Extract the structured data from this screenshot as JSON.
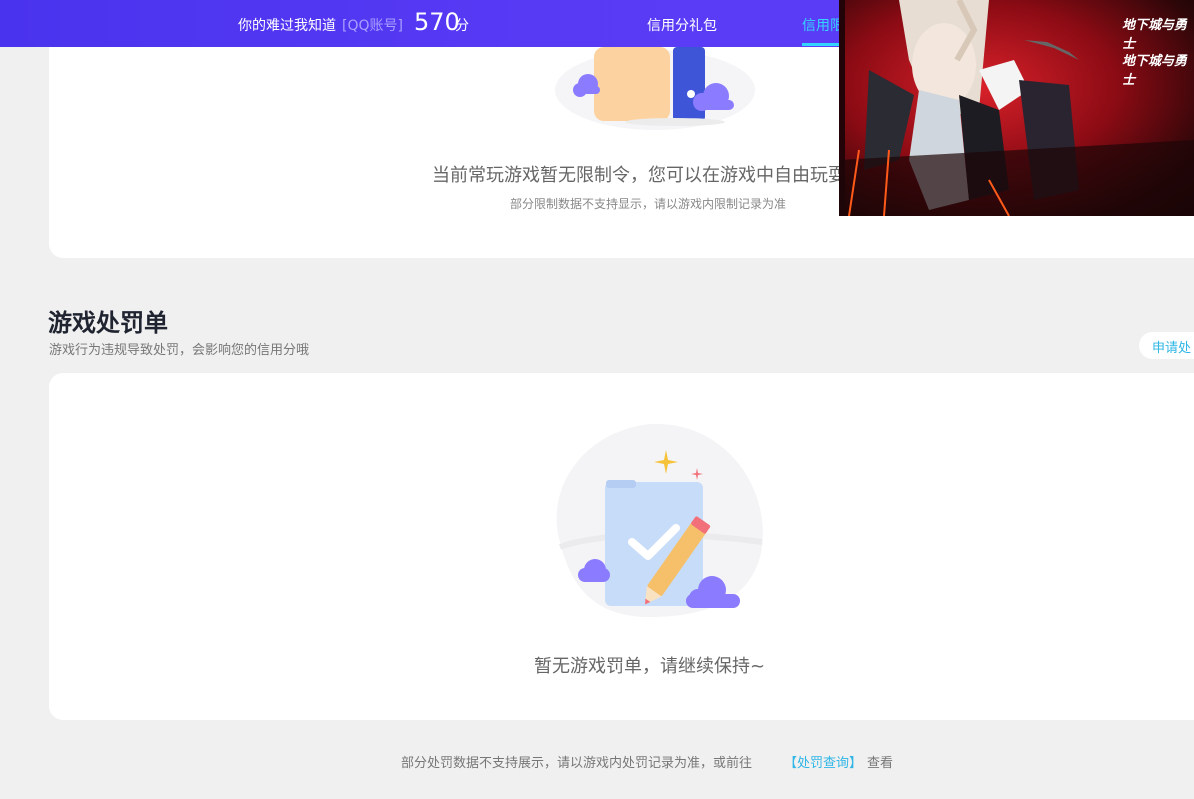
{
  "header": {
    "username": "你的难过我知道",
    "account_type": "[QQ账号]",
    "score": "570",
    "score_unit": "分",
    "nav": [
      {
        "label": "信用分礼包"
      },
      {
        "label": "信用限"
      }
    ]
  },
  "banner": {
    "logo_text_1": "地下城与勇士",
    "logo_text_2": "地下城与勇士"
  },
  "restrictions": {
    "message": "当前常玩游戏暂无限制令，您可以在游戏中自由玩耍",
    "note": "部分限制数据不支持显示，请以游戏内限制记录为准"
  },
  "penalty_section": {
    "title": "游戏处罚单",
    "description": "游戏行为违规导致处罚，会影响您的信用分哦",
    "apply_button": "申请处",
    "empty_message": "暂无游戏罚单，请继续保持~"
  },
  "footer": {
    "note": "部分处罚数据不支持展示，请以游戏内处罚记录为准，或前往",
    "link": "【处罚查询】",
    "suffix": "查看"
  },
  "colors": {
    "topbar": "#4a33ee",
    "accent": "#33d5ff",
    "link": "#2fb6e6",
    "background": "#f0f0f0"
  }
}
